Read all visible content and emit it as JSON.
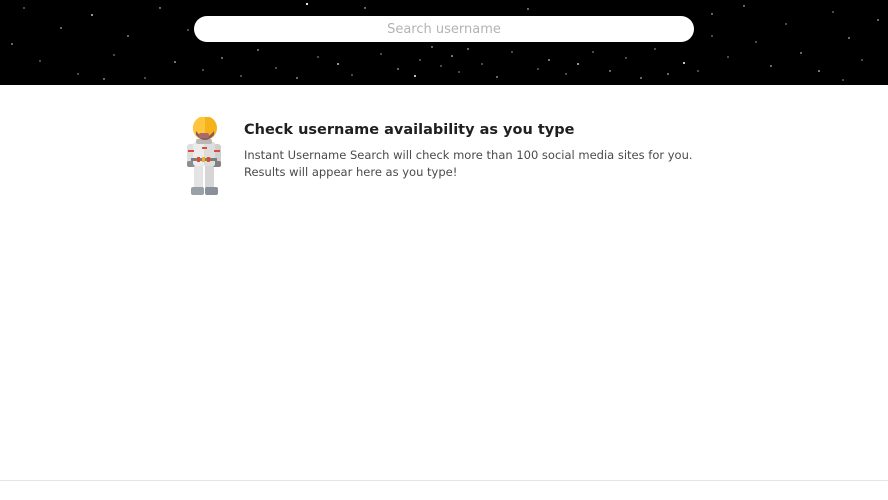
{
  "search": {
    "placeholder": "Search username",
    "value": ""
  },
  "intro": {
    "title": "Check username availability as you type",
    "body": "Instant Username Search will check more than 100 social media sites for you. Results will appear here as you type!"
  },
  "colors": {
    "header_background": "#000000",
    "helmet": "#f5b21b",
    "suit": "#e8e8e8",
    "accent_red": "#e04a3a"
  },
  "icons": {
    "mascot": "astronaut-icon"
  }
}
